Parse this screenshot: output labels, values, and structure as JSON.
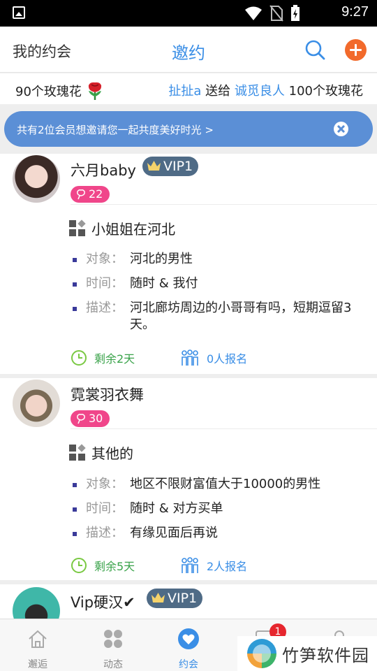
{
  "status_bar": {
    "time": "9:27"
  },
  "header": {
    "left_title": "我的约会",
    "center_title": "邀约"
  },
  "rose_bar": {
    "left_text": "90个玫瑰花",
    "giver": "扯扯a",
    "action": "送给",
    "receiver": "诚觅良人",
    "amount_text": "100个玫瑰花"
  },
  "banner": {
    "text": "共有2位会员想邀请您一起共度美好时光 >"
  },
  "posts": [
    {
      "username": "六月baby",
      "vip": "VIP1",
      "roses": "22",
      "category": "小姐姐在河北",
      "details": [
        {
          "key": "对象：",
          "value": "河北的男性"
        },
        {
          "key": "时间：",
          "value": "随时 & 我付"
        },
        {
          "key": "描述：",
          "value": "河北廊坊周边的小哥哥有吗，短期逗留3天。"
        }
      ],
      "remaining": "剩余2天",
      "signups": "0人报名"
    },
    {
      "username": "霓裳羽衣舞",
      "roses": "30",
      "category": "其他的",
      "details": [
        {
          "key": "对象：",
          "value": "地区不限财富值大于10000的男性"
        },
        {
          "key": "时间：",
          "value": "随时 & 对方买单"
        },
        {
          "key": "描述：",
          "value": "有缘见面后再说"
        }
      ],
      "remaining": "剩余5天",
      "signups": "2人报名"
    },
    {
      "username": "Vip硬汉✔",
      "vip": "VIP1"
    }
  ],
  "tabbar": {
    "tabs": [
      {
        "label": "邂逅",
        "icon": "home-icon"
      },
      {
        "label": "动态",
        "icon": "grid-icon"
      },
      {
        "label": "约会",
        "icon": "heart-icon",
        "active": true
      },
      {
        "label": "",
        "icon": "message-icon"
      },
      {
        "label": "",
        "icon": "profile-icon"
      }
    ],
    "message_badge": "1"
  },
  "watermark": {
    "text": "竹笋软件园"
  },
  "colors": {
    "accent": "#3a8ee6",
    "add_button": "#f26a2b",
    "banner": "#5b8fd6",
    "vip_badge": "#4f6b86",
    "roses_badge": "#f0468a",
    "remaining": "#3aa34a",
    "badge": "#e6262e"
  }
}
